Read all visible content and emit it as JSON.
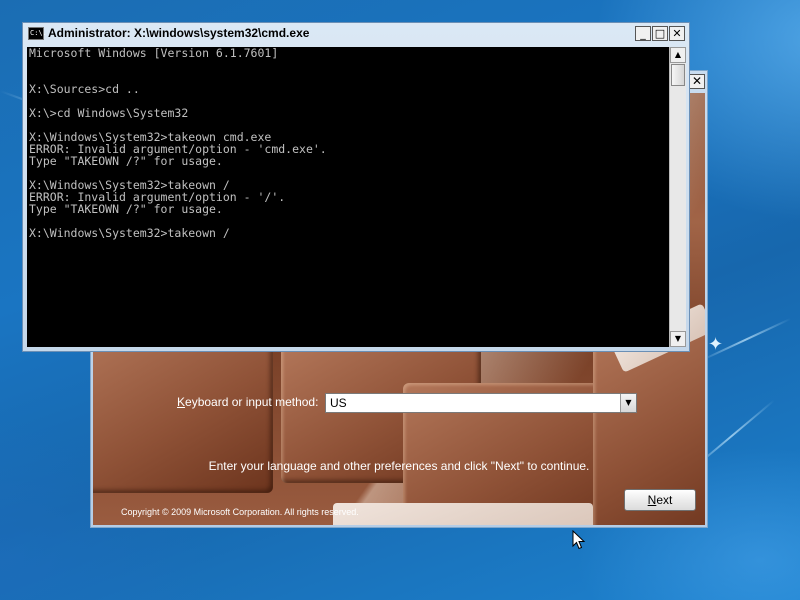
{
  "cmd_window": {
    "title": "Administrator: X:\\windows\\system32\\cmd.exe",
    "icon_label": "C:\\.",
    "controls": {
      "minimize": "_",
      "maximize": "□",
      "close": "✕"
    },
    "console_lines": [
      "Microsoft Windows [Version 6.1.7601]",
      "",
      "",
      "X:\\Sources>cd ..",
      "",
      "X:\\>cd Windows\\System32",
      "",
      "X:\\Windows\\System32>takeown cmd.exe",
      "ERROR: Invalid argument/option - 'cmd.exe'.",
      "Type \"TAKEOWN /?\" for usage.",
      "",
      "X:\\Windows\\System32>takeown /",
      "ERROR: Invalid argument/option - '/'.",
      "Type \"TAKEOWN /?\" for usage.",
      "",
      "X:\\Windows\\System32>takeown /"
    ]
  },
  "setup_window": {
    "close_glyph": "✕",
    "keyboard_label_accel": "K",
    "keyboard_label_rest": "eyboard or input method:",
    "keyboard_value": "US",
    "prompt": "Enter your language and other preferences and click \"Next\" to continue.",
    "copyright": "Copyright © 2009 Microsoft Corporation. All rights reserved.",
    "next_accel": "N",
    "next_rest": "ext"
  }
}
